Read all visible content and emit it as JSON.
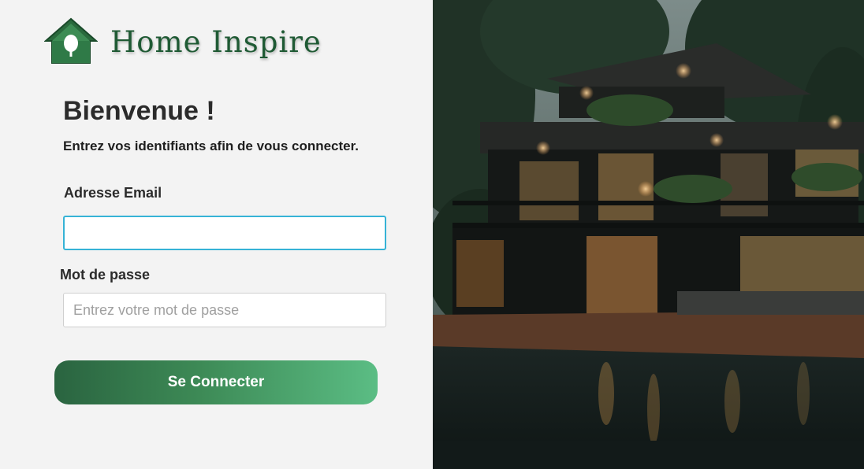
{
  "brand": {
    "name": "Home Inspire",
    "color": "#1f5a34"
  },
  "login": {
    "title": "Bienvenue !",
    "subtitle": "Entrez vos identifiants afin de vous connecter.",
    "email_label": "Adresse Email",
    "email_value": "",
    "email_placeholder": "",
    "password_label": "Mot de passe",
    "password_placeholder": "Entrez votre mot de passe",
    "submit_label": "Se Connecter"
  },
  "hero_image": {
    "icon": "house-photo"
  },
  "colors": {
    "accent_start": "#2a6440",
    "accent_end": "#5bbd84",
    "focus_border": "#36b3d6"
  }
}
